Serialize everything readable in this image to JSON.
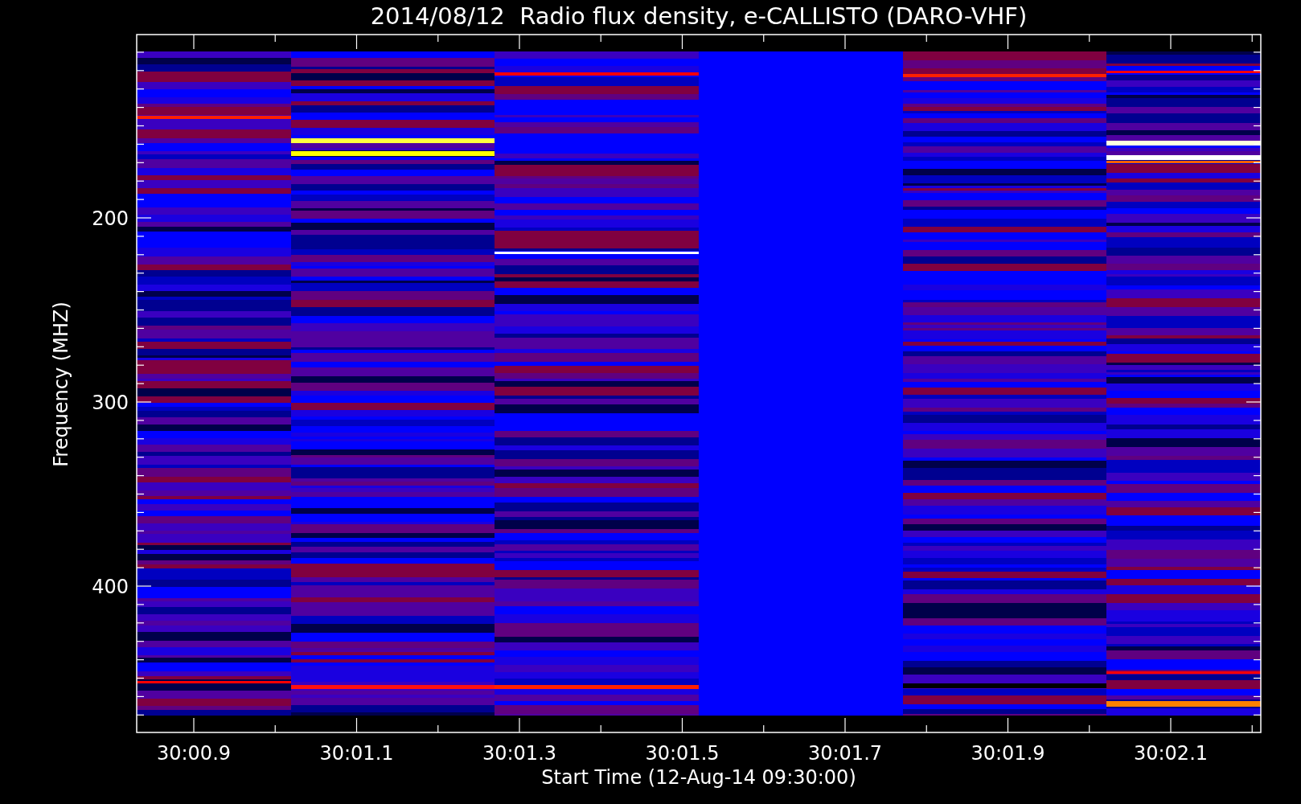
{
  "title": "2014/08/12  Radio flux density, e-CALLISTO (DARO-VHF)",
  "plot": {
    "ylabel": "Frequency (MHZ)",
    "xlabel": "Start Time (12-Aug-14 09:30:00)",
    "yticks": [
      "200",
      "300",
      "400"
    ],
    "xticks": [
      "30:00.9",
      "30:01.1",
      "30:01.3",
      "30:01.5",
      "30:01.7",
      "30:01.9",
      "30:02.1"
    ]
  }
}
